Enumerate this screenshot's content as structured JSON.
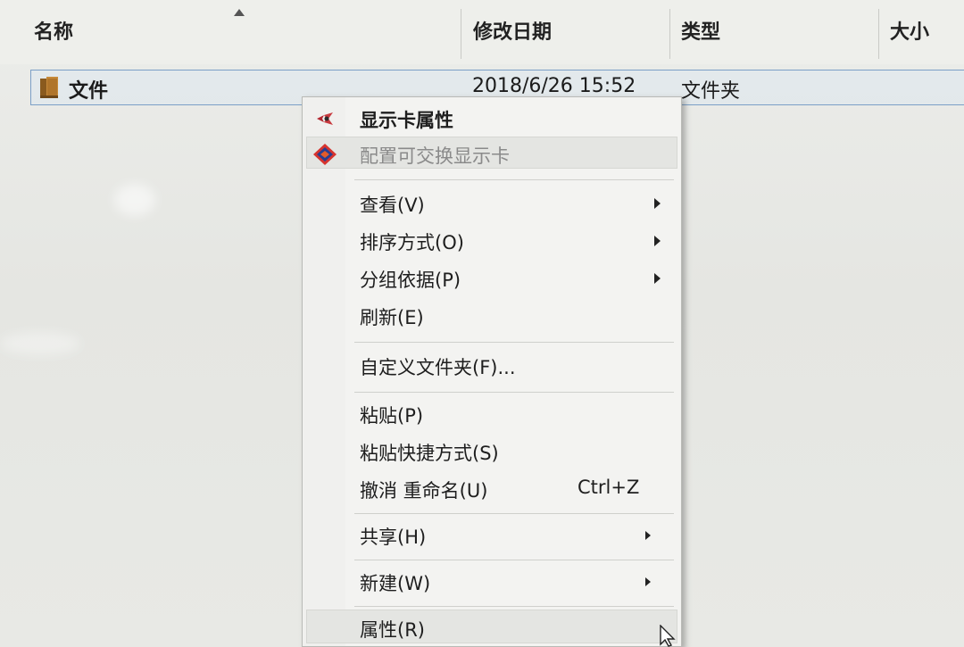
{
  "columns": {
    "name": "名称",
    "modified": "修改日期",
    "type": "类型",
    "size": "大小"
  },
  "file": {
    "name": "文件",
    "modified": "2018/6/26 15:52",
    "type": "文件夹",
    "icon": "folder-icon"
  },
  "menu": {
    "display_props": {
      "label": "显示卡属性",
      "icon": "graphics-settings-icon"
    },
    "switchable": {
      "label": "配置可交换显示卡",
      "icon": "switchable-graphics-icon"
    },
    "view": {
      "label": "查看(V)"
    },
    "sort": {
      "label": "排序方式(O)"
    },
    "group": {
      "label": "分组依据(P)"
    },
    "refresh": {
      "label": "刷新(E)"
    },
    "customize": {
      "label": "自定义文件夹(F)..."
    },
    "paste": {
      "label": "粘贴(P)"
    },
    "paste_shortcut": {
      "label": "粘贴快捷方式(S)"
    },
    "undo_rename": {
      "label": "撤消 重命名(U)",
      "shortcut": "Ctrl+Z"
    },
    "share": {
      "label": "共享(H)"
    },
    "new": {
      "label": "新建(W)"
    },
    "properties": {
      "label": "属性(R)"
    }
  },
  "colors": {
    "selection_border": "#7b9fc6",
    "menu_background": "#f3f3f1",
    "disabled_text": "#8a8a8a"
  }
}
